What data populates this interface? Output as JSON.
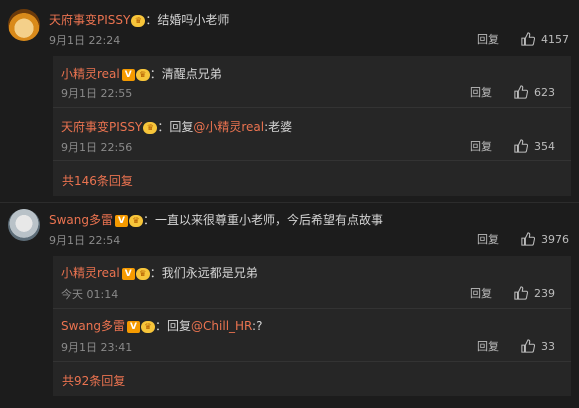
{
  "comments": [
    {
      "user": "天府事变PISSY",
      "colon": "：",
      "text": "结婚吗小老师",
      "time": "9月1日 22:24",
      "reply_label": "回复",
      "likes": "4157",
      "replies": [
        {
          "user": "小精灵real",
          "colon": "：",
          "text": "清醒点兄弟",
          "time": "9月1日 22:55",
          "reply_label": "回复",
          "likes": "623"
        },
        {
          "user": "天府事变PISSY",
          "colon": "：",
          "prefix": "回复",
          "mention": "@小精灵real",
          "text": ":老婆",
          "time": "9月1日 22:56",
          "reply_label": "回复",
          "likes": "354"
        }
      ],
      "more": "共146条回复"
    },
    {
      "user": "Swang多雷",
      "colon": "：",
      "text": "一直以来很尊重小老师，今后希望有点故事",
      "time": "9月1日 22:54",
      "reply_label": "回复",
      "likes": "3976",
      "replies": [
        {
          "user": "小精灵real",
          "colon": "：",
          "text": "我们永远都是兄弟",
          "time": "今天 01:14",
          "reply_label": "回复",
          "likes": "239"
        },
        {
          "user": "Swang多雷",
          "colon": "：",
          "prefix": "回复",
          "mention": "@Chill_HR",
          "text": ":?",
          "time": "9月1日 23:41",
          "reply_label": "回复",
          "likes": "33"
        }
      ],
      "more": "共92条回复"
    }
  ],
  "badges": {
    "verified": "V",
    "fan": "♛"
  },
  "colors": {
    "accent": "#eb7350",
    "background": "#1c1c1c",
    "reply_box": "#262626",
    "verified": "#f59a00"
  },
  "icons": {
    "like": "thumbs-up-icon"
  }
}
